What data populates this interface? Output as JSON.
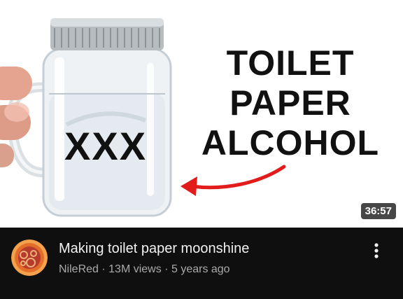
{
  "thumbnail": {
    "headline_lines": [
      "TOILET",
      "PAPER",
      "ALCOHOL"
    ],
    "jar_marks": "XXX",
    "duration": "36:57",
    "arrow_color": "#e21b1b"
  },
  "video": {
    "title": "Making toilet paper moonshine",
    "channel": "NileRed",
    "views": "13M views",
    "age": "5 years ago",
    "separator": "·",
    "menu_icon": "more-vertical-icon"
  },
  "theme": {
    "background": "#0f0f0f",
    "title_color": "#f1f1f1",
    "subtitle_color": "#aaaaaa"
  }
}
